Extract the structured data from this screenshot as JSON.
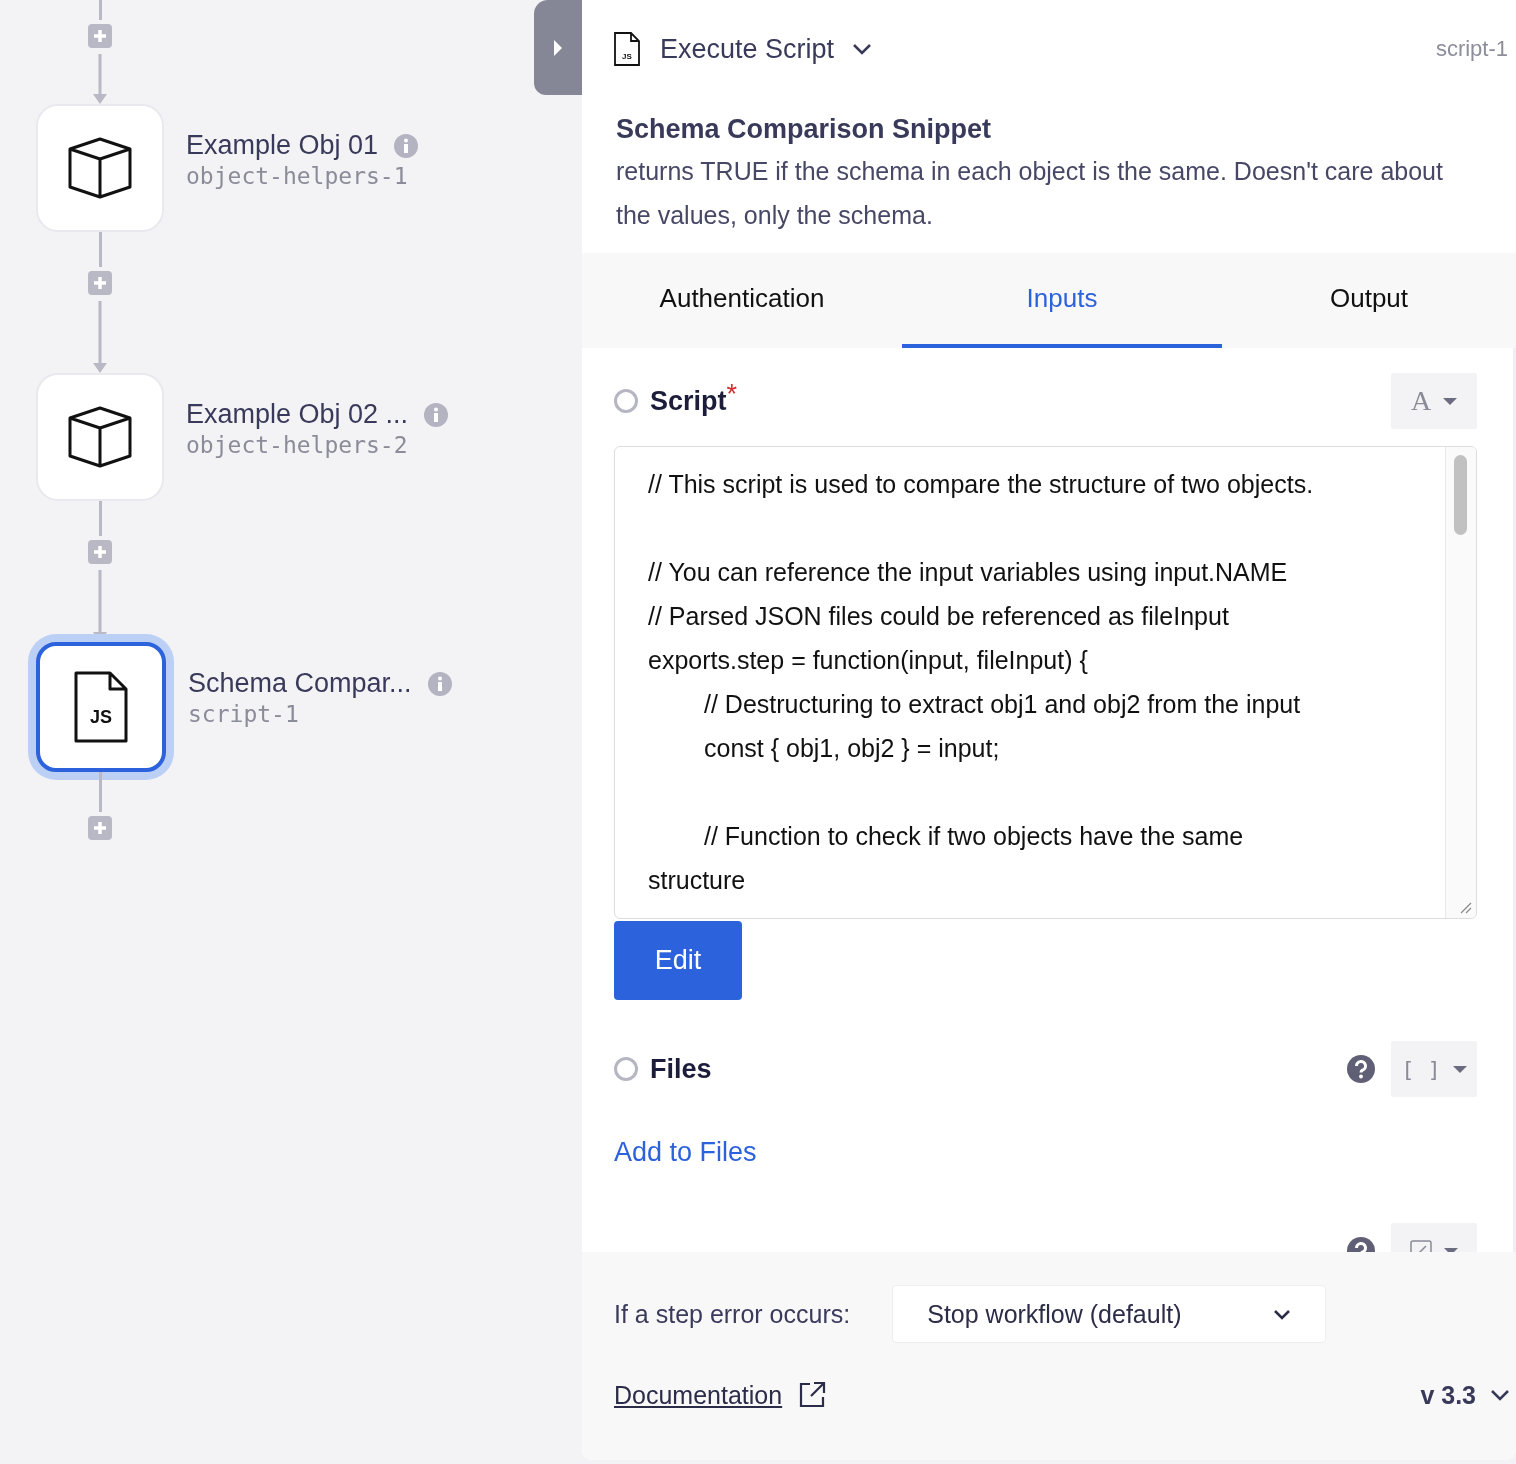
{
  "steps": [
    {
      "kind": "object",
      "title": "Example Obj 01",
      "id": "object-helpers-1",
      "selected": false
    },
    {
      "kind": "object",
      "title": "Example Obj 02 ...",
      "id": "object-helpers-2",
      "selected": false
    },
    {
      "kind": "script",
      "icon_label": "JS",
      "title": "Schema Compar...",
      "id": "script-1",
      "selected": true
    }
  ],
  "panel": {
    "header": {
      "icon_label": "JS",
      "title": "Execute Script",
      "step_id": "script-1"
    },
    "name": "Schema Comparison Snippet",
    "description": "returns TRUE if the schema in each object is the same. Doesn't care about the values, only the schema.",
    "tabs": [
      {
        "label": "Authentication",
        "selected": false
      },
      {
        "label": "Inputs",
        "selected": true
      },
      {
        "label": "Output",
        "selected": false
      }
    ],
    "fields": [
      {
        "kind": "code",
        "label": "Script",
        "required_mark": "*",
        "checked": false,
        "help": false,
        "type_label": "A",
        "value": "// This script is used to compare the structure of two objects.\n\n// You can reference the input variables using input.NAME\n// Parsed JSON files could be referenced as fileInput\nexports.step = function(input, fileInput) {\n\t// Destructuring to extract obj1 and obj2 from the input\n\tconst { obj1, obj2 } = input;\n\n\t// Function to check if two objects have the same structure",
        "button": "Edit"
      },
      {
        "kind": "list",
        "label": "Files",
        "checked": false,
        "help": true,
        "type_label": "[ ]",
        "action": "Add to Files"
      },
      {
        "kind": "partial",
        "help": true
      }
    ],
    "footer": {
      "error_label": "If a step error occurs:",
      "error_option": "Stop workflow (default)",
      "docs_link": "Documentation",
      "version": "v 3.3"
    }
  }
}
